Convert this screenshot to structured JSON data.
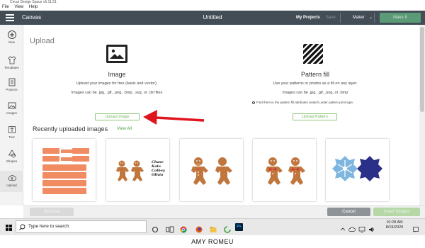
{
  "os": {
    "title": "Cricut Design Space v5.11.51",
    "menu": [
      "File",
      "View",
      "Help"
    ]
  },
  "header": {
    "canvas_label": "Canvas",
    "title": "Untitled",
    "my_projects": "My Projects",
    "save": "Save",
    "machine": "Maker",
    "make_it": "Make It"
  },
  "sidebar": {
    "items": [
      {
        "label": "New",
        "icon": "plus-icon"
      },
      {
        "label": "Templates",
        "icon": "shirt-icon"
      },
      {
        "label": "Projects",
        "icon": "projects-icon"
      },
      {
        "label": "Images",
        "icon": "image-icon"
      },
      {
        "label": "Text",
        "icon": "text-icon"
      },
      {
        "label": "Shapes",
        "icon": "shapes-icon"
      },
      {
        "label": "Upload",
        "icon": "upload-cloud-icon"
      }
    ]
  },
  "main": {
    "heading": "Upload",
    "image_option": {
      "title": "Image",
      "desc1": "Upload your images for free (basic and vector).",
      "desc2": "Images can be .jpg, .gif, .png, .bmp, .svg, or .dxf files",
      "button": "Upload Image"
    },
    "pattern_option": {
      "title": "Pattern fill",
      "desc1": "Use your patterns or photos as a fill on any layer.",
      "desc2": "Images can be .jpg, .gif, .png, or .bmp",
      "note": "Find them in the pattern fill attributes swatch under pattern print type.",
      "button": "Upload Pattern"
    },
    "recent": {
      "title": "Recently uploaded images",
      "view_all": "View All"
    },
    "thumb_text": [
      "Chase",
      "Kate",
      "Colbey",
      "Olivia"
    ]
  },
  "actions": {
    "remove": "Remove",
    "cancel": "Cancel",
    "insert": "Insert Images"
  },
  "taskbar": {
    "search_placeholder": "Type here to search",
    "time": "10:28 AM",
    "date": "8/19/2020"
  },
  "footer": {
    "credit": "AMY ROMEU"
  },
  "colors": {
    "header_bg": "#434d56",
    "accent_green": "#78b560",
    "arrow_red": "#e0141e",
    "gingerbread": "#c0763c",
    "snowflake_light": "#7fb6e0",
    "snowflake_dark": "#2a2f88",
    "label_orange": "#f08b62"
  }
}
